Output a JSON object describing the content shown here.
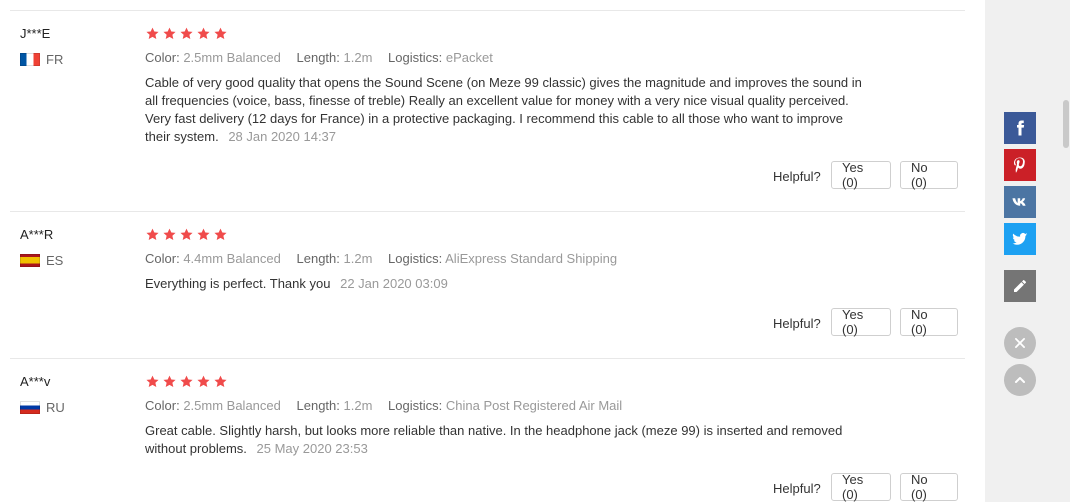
{
  "ui": {
    "helpful_label": "Helpful?",
    "color_key": "Color:",
    "length_key": "Length:",
    "logistics_key": "Logistics:",
    "yes_label": "Yes (0)",
    "no_label": "No (0)"
  },
  "reviews": [
    {
      "user": "J***E",
      "country": "FR",
      "rating_stars": 5,
      "color": "2.5mm Balanced",
      "length": "1.2m",
      "logistics": "ePacket",
      "text": "Cable of very good quality that opens the Sound Scene (on Meze 99 classic) gives the magnitude and improves the sound in all frequencies (voice, bass, finesse of treble) Really an excellent value for money with a very nice visual quality perceived. Very fast delivery (12 days for France) in a protective packaging. I recommend this cable to all those who want to improve their system.",
      "date": "28 Jan 2020 14:37"
    },
    {
      "user": "A***R",
      "country": "ES",
      "rating_stars": 5,
      "color": "4.4mm Balanced",
      "length": "1.2m",
      "logistics": "AliExpress Standard Shipping",
      "text": "Everything is perfect. Thank you",
      "date": "22 Jan 2020 03:09"
    },
    {
      "user": "A***v",
      "country": "RU",
      "rating_stars": 5,
      "color": "2.5mm Balanced",
      "length": "1.2m",
      "logistics": "China Post Registered Air Mail",
      "text": "Great cable. Slightly harsh, but looks more reliable than native. In the headphone jack (meze 99) is inserted and removed without problems.",
      "date": "25 May 2020 23:53"
    }
  ],
  "colors": {
    "star": "#f04b4b",
    "facebook": "#3b5998",
    "pinterest": "#cb2027",
    "vk": "#4c75a3",
    "twitter": "#1da1f2",
    "edit": "#757575",
    "round_btn": "#bdbdbd"
  },
  "side_actions": {
    "icons": [
      "facebook-icon",
      "pinterest-icon",
      "vk-icon",
      "twitter-icon",
      "edit-icon",
      "close-icon",
      "chevron-up-icon"
    ]
  }
}
